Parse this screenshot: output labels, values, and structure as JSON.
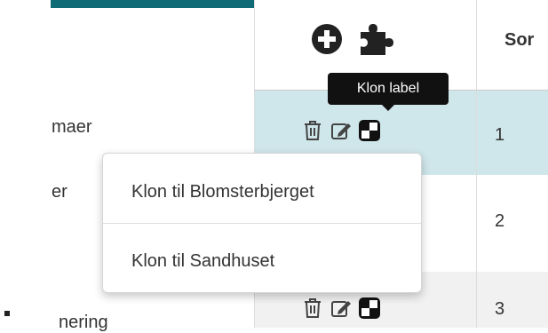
{
  "header": {
    "sort_label": "Sor",
    "add_icon": "plus-circle-icon",
    "plugin_icon": "puzzle-piece-icon"
  },
  "tooltip": {
    "text": "Klon label"
  },
  "rows": [
    {
      "name": "maer",
      "sort": "1",
      "icons": [
        "trash-icon",
        "edit-icon",
        "clone-icon"
      ]
    },
    {
      "name": "er",
      "sort": "2",
      "icons": []
    },
    {
      "name": "nering",
      "sort": "3",
      "icons": [
        "trash-icon",
        "edit-icon",
        "clone-icon"
      ]
    }
  ],
  "clone_menu": {
    "items": [
      {
        "label": "Klon til Blomsterbjerget"
      },
      {
        "label": "Klon til Sandhuset"
      }
    ]
  },
  "colors": {
    "teal": "#0f6b76",
    "selected_row": "#cfe6ea",
    "tooltip_bg": "#111111"
  }
}
